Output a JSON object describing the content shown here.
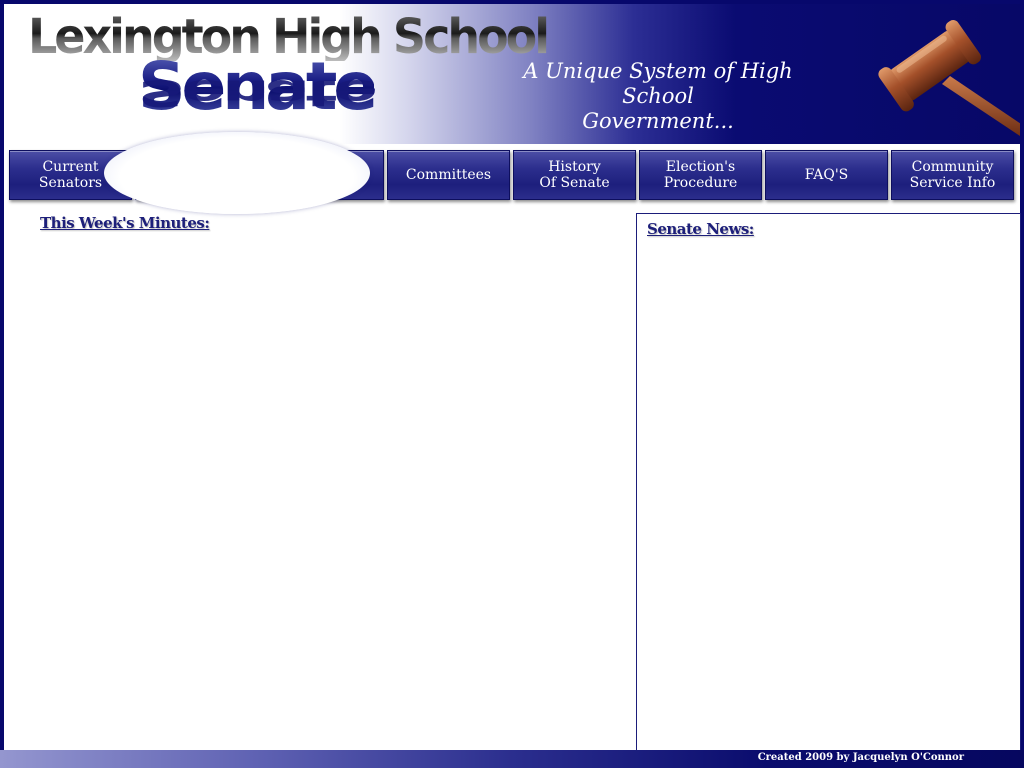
{
  "header": {
    "school_title": "Lexington High School",
    "senate_word": "Senate",
    "tagline_line1": "A Unique System of High School",
    "tagline_line2": "Government...",
    "logo_icon": "gavel-icon"
  },
  "nav": {
    "items": [
      {
        "label": "Current\nSenators"
      },
      {
        "label": ""
      },
      {
        "label": ""
      },
      {
        "label": "Committees"
      },
      {
        "label": "History\nOf Senate"
      },
      {
        "label": "Election's\nProcedure"
      },
      {
        "label": "FAQ'S"
      },
      {
        "label": "Community\nService Info"
      }
    ]
  },
  "main": {
    "minutes_heading": "This Week's Minutes:",
    "news_heading": "Senate News:"
  },
  "footer": {
    "credit": "Created 2009 by Jacquelyn O'Connor"
  },
  "colors": {
    "navy": "#07086c",
    "button": "#2d2f8e",
    "heading": "#1d1f7a"
  }
}
